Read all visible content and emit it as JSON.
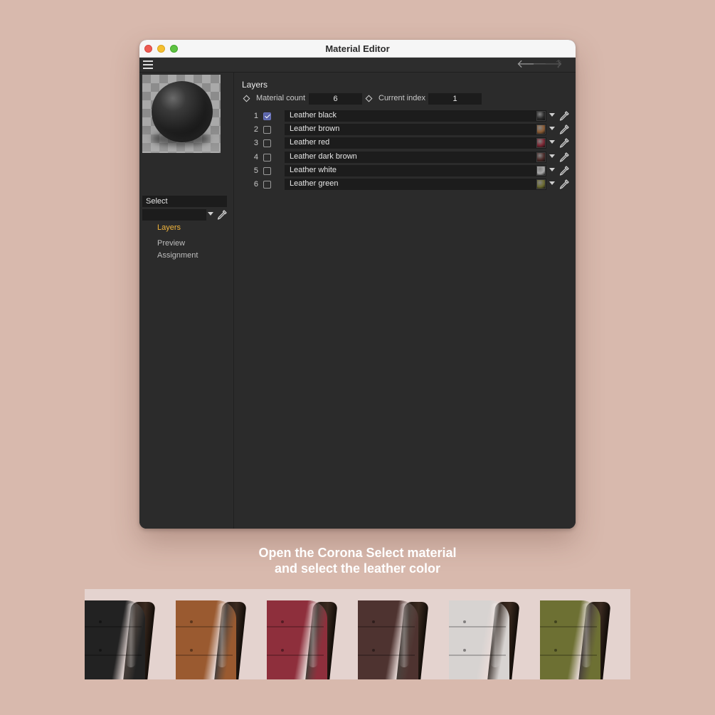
{
  "window": {
    "title": "Material Editor"
  },
  "toolbar": {
    "menu_icon": "hamburger-menu-icon",
    "back_icon": "arrow-left-icon",
    "forward_icon": "arrow-right-icon",
    "up_icon": "arrow-up-icon",
    "back_glyph": "🡐",
    "forward_glyph": "🡒",
    "up_glyph": "🡑"
  },
  "left_panel": {
    "material_name": "Select",
    "nav": {
      "layers": "Layers",
      "preview": "Preview",
      "assignment": "Assignment"
    },
    "active_nav": "Layers"
  },
  "layers_panel": {
    "title": "Layers",
    "material_count_label": "Material count",
    "material_count_value": "6",
    "current_index_label": "Current index",
    "current_index_value": "1",
    "rows": [
      {
        "num": "1",
        "checked": true,
        "name": "Leather black",
        "swatch": "#2a2a2a"
      },
      {
        "num": "2",
        "checked": false,
        "name": "Leather brown",
        "swatch": "#8a5a32"
      },
      {
        "num": "3",
        "checked": false,
        "name": "Leather red",
        "swatch": "#7a2431"
      },
      {
        "num": "4",
        "checked": false,
        "name": "Leather dark brown",
        "swatch": "#4a2a28"
      },
      {
        "num": "5",
        "checked": false,
        "name": "Leather white",
        "swatch": "#a8a8a8"
      },
      {
        "num": "6",
        "checked": false,
        "name": "Leather green",
        "swatch": "#6b6a2e"
      }
    ]
  },
  "caption": {
    "line1": "Open the Corona Select material",
    "line2": "and select the leather color"
  },
  "swatch_strip": {
    "colors": [
      "#222222",
      "#9a5a30",
      "#8e2f3c",
      "#4e3330",
      "#d7d3d1",
      "#6d7033"
    ]
  },
  "accent_color": "#f2b53c"
}
